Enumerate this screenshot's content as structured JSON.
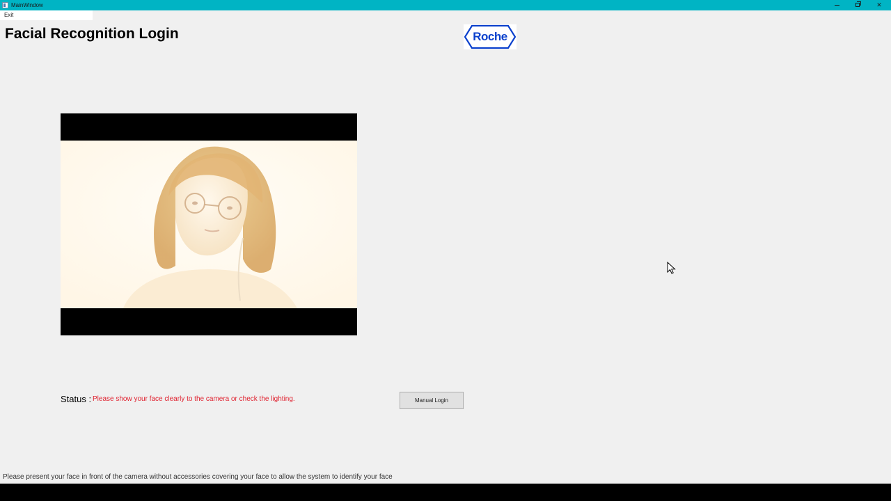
{
  "window": {
    "title": "MainWindow",
    "controls": {
      "minimize": "minimize-icon",
      "maximize": "restore-icon",
      "close": "close-icon"
    }
  },
  "menu": {
    "items": [
      {
        "label": "Exit"
      }
    ]
  },
  "page": {
    "title": "Facial Recognition Login"
  },
  "logo": {
    "text": "Roche",
    "color": "#0b41cd"
  },
  "camera": {
    "feed": "webcam-preview"
  },
  "status": {
    "label": "Status :",
    "message": "Please show your face clearly to the camera or check the lighting.",
    "message_color": "#e0202e"
  },
  "buttons": {
    "manual_login": "Manual Login"
  },
  "status_bar": {
    "text": "Please present your face in front of the camera without accessories covering your face to allow the system to identify your face"
  },
  "colors": {
    "titlebar": "#00b4c4",
    "background": "#f0f0f0"
  }
}
